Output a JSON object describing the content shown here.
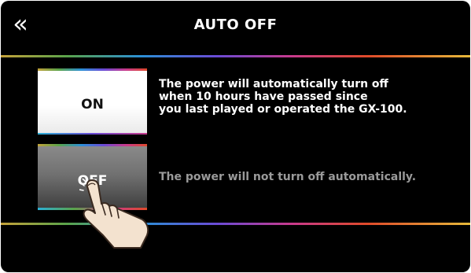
{
  "header": {
    "back_glyph": "«",
    "title": "AUTO OFF"
  },
  "options": {
    "on": {
      "label": "ON",
      "description_lines": [
        "The power will automatically turn off",
        "when 10 hours have passed since",
        "you last played or operated the GX-100."
      ]
    },
    "off": {
      "label": "OFF",
      "description": "The power will not turn off automatically."
    }
  },
  "state": {
    "selected": "OFF"
  },
  "colors": {
    "background": "#000000",
    "text_active": "#ffffff",
    "text_inactive": "#9a9a9a"
  },
  "icons": {
    "back": "double-chevron-left-icon",
    "pointer": "pointing-hand-icon"
  }
}
